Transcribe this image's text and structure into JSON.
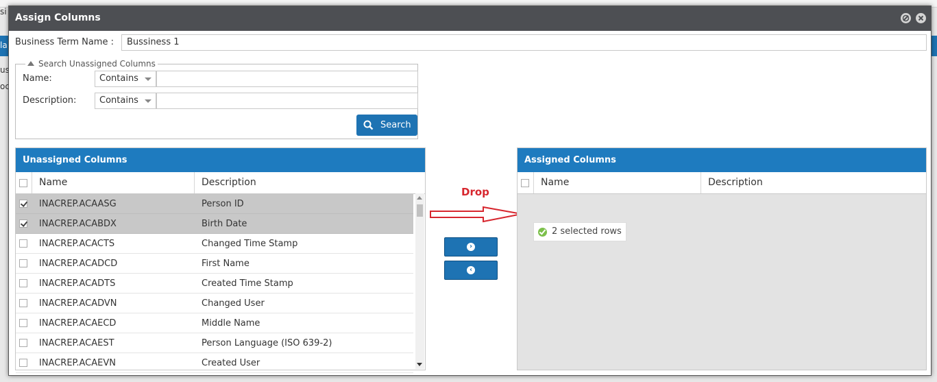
{
  "background": {
    "fragments": [
      "si",
      "la",
      "us",
      "oc"
    ]
  },
  "dialog": {
    "title": "Assign Columns",
    "controls": [
      "minimize-icon",
      "close-icon"
    ]
  },
  "business_term": {
    "label": "Business Term Name :",
    "value": "Bussiness 1"
  },
  "search": {
    "legend": "Search Unassigned Columns",
    "name_label": "Name:",
    "name_operator": "Contains",
    "name_value": "",
    "description_label": "Description:",
    "description_operator": "Contains",
    "description_value": "",
    "button_label": "Search"
  },
  "unassigned": {
    "title": "Unassigned Columns",
    "columns": [
      "Name",
      "Description"
    ],
    "rows": [
      {
        "name": "INACREP.ACAASG",
        "description": "Person ID",
        "checked": true
      },
      {
        "name": "INACREP.ACABDX",
        "description": "Birth Date",
        "checked": true
      },
      {
        "name": "INACREP.ACACTS",
        "description": "Changed Time Stamp",
        "checked": false
      },
      {
        "name": "INACREP.ACADCD",
        "description": "First Name",
        "checked": false
      },
      {
        "name": "INACREP.ACADTS",
        "description": "Created Time Stamp",
        "checked": false
      },
      {
        "name": "INACREP.ACADVN",
        "description": "Changed User",
        "checked": false
      },
      {
        "name": "INACREP.ACAECD",
        "description": "Middle Name",
        "checked": false
      },
      {
        "name": "INACREP.ACAEST",
        "description": "Person Language (ISO 639-2)",
        "checked": false
      },
      {
        "name": "INACREP.ACAEVN",
        "description": "Created User",
        "checked": false
      }
    ]
  },
  "assigned": {
    "title": "Assigned Columns",
    "columns": [
      "Name",
      "Description"
    ],
    "drag_badge": "2 selected rows"
  },
  "annotation": {
    "drop_label": "Drop",
    "color": "#d7262e"
  },
  "colors": {
    "header_dark": "#4d4f53",
    "grid_title_blue": "#1e7bbf",
    "button_blue": "#1e73b3",
    "selected_row": "#c8c8c8"
  }
}
